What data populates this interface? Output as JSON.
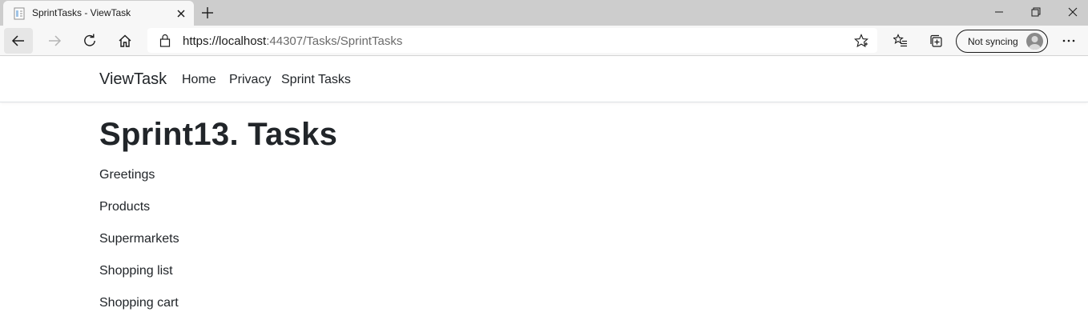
{
  "browser": {
    "tab": {
      "title": "SprintTasks - ViewTask"
    },
    "address": {
      "scheme_host": "https://localhost",
      "rest": ":44307/Tasks/SprintTasks"
    },
    "profile": {
      "sync_label": "Not syncing"
    }
  },
  "navbar": {
    "brand": "ViewTask",
    "links": [
      "Home",
      "Privacy",
      "Sprint Tasks"
    ]
  },
  "main": {
    "title": "Sprint13. Tasks",
    "tasks": [
      "Greetings",
      "Products",
      "Supermarkets",
      "Shopping list",
      "Shopping cart"
    ]
  },
  "icons": {
    "favicon": "page-icon",
    "back": "arrow-left-icon",
    "forward": "arrow-right-icon",
    "refresh": "refresh-icon",
    "home": "home-icon",
    "lock": "lock-icon",
    "favorite": "star-icon",
    "favorites": "favorites-list-icon",
    "collections": "collections-icon",
    "more": "ellipsis-icon"
  },
  "colors": {
    "tab_strip": "#cdcdcd",
    "toolbar": "#f7f7f7",
    "text": "#212529"
  }
}
